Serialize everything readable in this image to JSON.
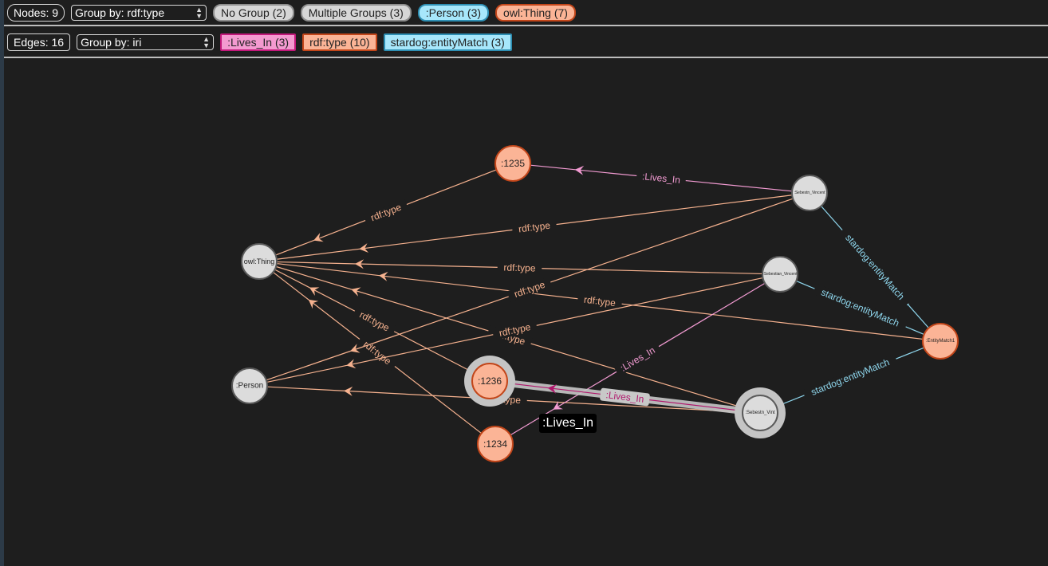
{
  "nodes_bar": {
    "count_label": "Nodes: 9",
    "group_by": "Group by:  rdf:type",
    "chips": [
      {
        "label": "No Group (2)",
        "bg": "#d6d6d6",
        "border": "#8e8e8e"
      },
      {
        "label": "Multiple Groups (3)",
        "bg": "#d6d6d6",
        "border": "#8e8e8e"
      },
      {
        "label": ":Person (3)",
        "bg": "#a7e7fb",
        "border": "#2e8fb3"
      },
      {
        "label": "owl:Thing (7)",
        "bg": "#fbb496",
        "border": "#c2461a"
      }
    ]
  },
  "edges_bar": {
    "count_label": "Edges: 16",
    "group_by": "Group by:  iri",
    "chips": [
      {
        "label": ":Lives_In (3)",
        "bg": "#f49ad0",
        "border": "#c2187a"
      },
      {
        "label": "rdf:type (10)",
        "bg": "#fbb496",
        "border": "#c2461a"
      },
      {
        "label": "stardog:entityMatch (3)",
        "bg": "#a7e7fb",
        "border": "#2e8fb3"
      }
    ]
  },
  "colors": {
    "rdf_type": "#f6b28f",
    "lives_in": "#f29bd2",
    "lives_in_selected": "#b0176c",
    "entity_match": "#8fd7ee",
    "gray_node_fill": "#dcdcdc",
    "gray_node_stroke": "#5a5a5a",
    "orange_node_fill": "#fbb496",
    "orange_node_stroke": "#c2461a"
  },
  "graph": {
    "nodes": [
      {
        "id": "owl_thing",
        "label": "owl:Thing",
        "kind": "gray",
        "font": 9
      },
      {
        "id": "person",
        "label": ":Person",
        "kind": "gray",
        "font": 10
      },
      {
        "id": "n1235",
        "label": ":1235",
        "kind": "orange",
        "font": 12
      },
      {
        "id": "n1236",
        "label": ":1236",
        "kind": "orange",
        "font": 12,
        "selected": true
      },
      {
        "id": "n1234",
        "label": ":1234",
        "kind": "orange",
        "font": 12
      },
      {
        "id": "sv1",
        "label": ":Sebestn_Vincent",
        "kind": "gray",
        "font": 5
      },
      {
        "id": "sv2",
        "label": ":Sebestian_Vincent",
        "kind": "gray",
        "font": 5
      },
      {
        "id": "sv3",
        "label": ":Sebestn_Vint",
        "kind": "gray",
        "font": 6,
        "selected": true
      },
      {
        "id": "em1",
        "label": ":EntityMatch1",
        "kind": "orange",
        "font": 6
      }
    ],
    "edges": [
      {
        "from": "n1235",
        "to": "owl_thing",
        "type": "rdf_type",
        "label": "rdf:type"
      },
      {
        "from": "sv1",
        "to": "owl_thing",
        "type": "rdf_type",
        "label": "rdf:type"
      },
      {
        "from": "sv2",
        "to": "owl_thing",
        "type": "rdf_type",
        "label": "rdf:type"
      },
      {
        "from": "em1",
        "to": "owl_thing",
        "type": "rdf_type",
        "label": "rdf:type"
      },
      {
        "from": "sv3",
        "to": "owl_thing",
        "type": "rdf_type",
        "label": "rdf:type"
      },
      {
        "from": "n1236",
        "to": "owl_thing",
        "type": "rdf_type",
        "label": "rdf:type"
      },
      {
        "from": "n1234",
        "to": "owl_thing",
        "type": "rdf_type",
        "label": "rdf:type"
      },
      {
        "from": "sv1",
        "to": "person",
        "type": "rdf_type",
        "label": "rdf:type"
      },
      {
        "from": "sv2",
        "to": "person",
        "type": "rdf_type",
        "label": "rdf:type"
      },
      {
        "from": "sv3",
        "to": "person",
        "type": "rdf_type",
        "label": "rdf:type"
      },
      {
        "from": "sv1",
        "to": "n1235",
        "type": "lives_in",
        "label": ":Lives_In"
      },
      {
        "from": "sv2",
        "to": "n1234",
        "type": "lives_in",
        "label": ":Lives_In"
      },
      {
        "from": "sv3",
        "to": "n1236",
        "type": "lives_in",
        "label": ":Lives_In",
        "selected": true
      },
      {
        "from": "sv1",
        "to": "em1",
        "type": "entity_match",
        "label": "stardog:entityMatch"
      },
      {
        "from": "sv2",
        "to": "em1",
        "type": "entity_match",
        "label": "stardog:entityMatch"
      },
      {
        "from": "sv3",
        "to": "em1",
        "type": "entity_match",
        "label": "stardog:entityMatch"
      }
    ]
  },
  "tooltip": ":Lives_In"
}
